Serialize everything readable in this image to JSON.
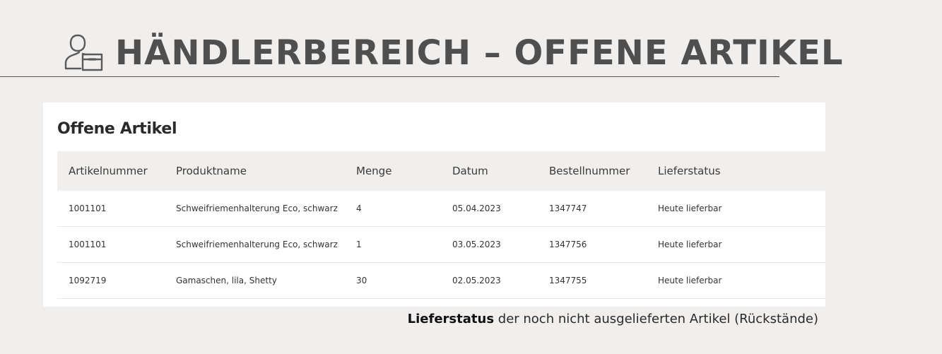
{
  "header": {
    "title": "HÄNDLERBEREICH – OFFENE ARTIKEL",
    "icon": "dealer-person-box-icon"
  },
  "panel": {
    "title": "Offene Artikel"
  },
  "table": {
    "columns": [
      "Artikelnummer",
      "Produktname",
      "Menge",
      "Datum",
      "Bestellnummer",
      "Lieferstatus"
    ],
    "rows": [
      [
        "1001101",
        "Schweifriemenhalterung Eco, schwarz",
        "4",
        "05.04.2023",
        "1347747",
        "Heute lieferbar"
      ],
      [
        "1001101",
        "Schweifriemenhalterung Eco, schwarz",
        "1",
        "03.05.2023",
        "1347756",
        "Heute lieferbar"
      ],
      [
        "1092719",
        "Gamaschen, lila, Shetty",
        "30",
        "02.05.2023",
        "1347755",
        "Heute lieferbar"
      ]
    ]
  },
  "caption": {
    "bold": "Lieferstatus",
    "rest": " der noch nicht ausgelieferten Artikel (Rückstände)"
  }
}
